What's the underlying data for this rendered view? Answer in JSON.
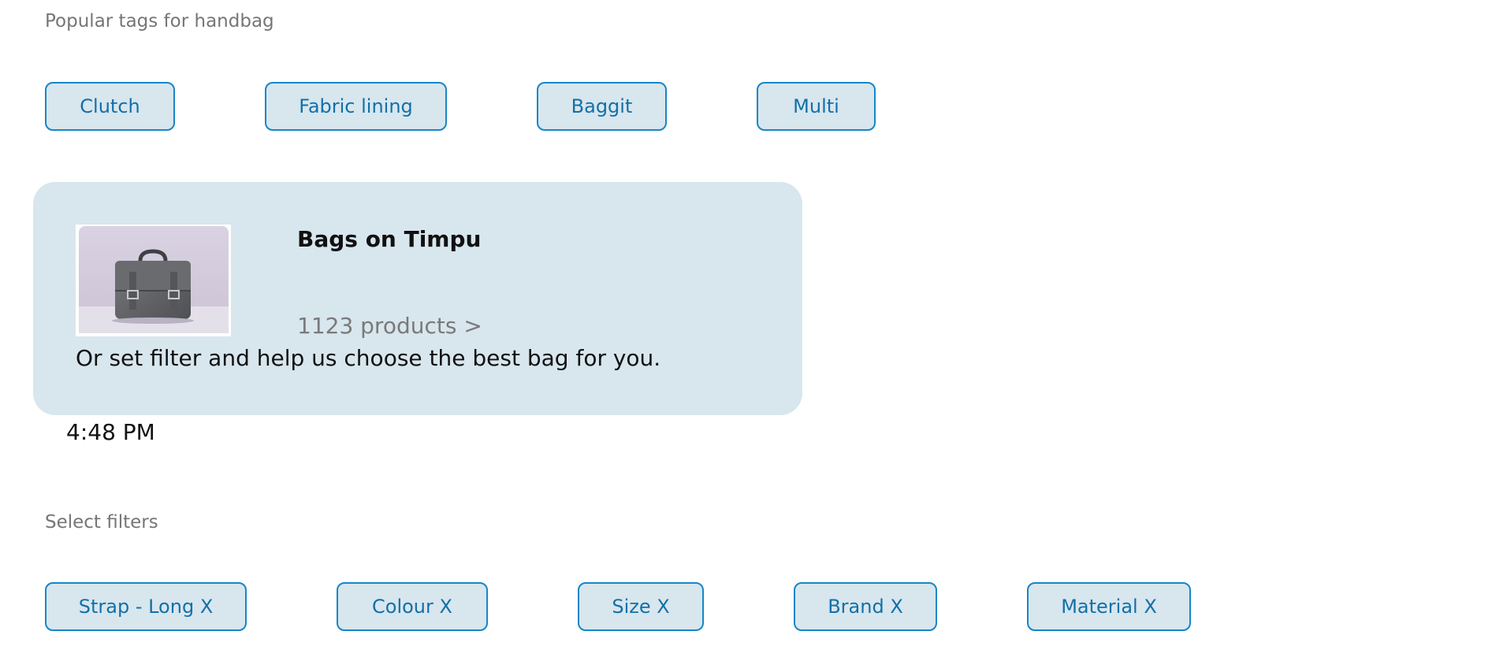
{
  "tags": {
    "label": "Popular tags for handbag",
    "items": [
      "Clutch",
      "Fabric lining",
      "Baggit",
      "Multi"
    ]
  },
  "card": {
    "title": "Bags on Timpu",
    "count_text": "1123 products >",
    "message": "Or set filter and help us choose the best bag for you.",
    "image_icon": "handbag-photo"
  },
  "timestamp": "4:48 PM",
  "filters": {
    "label": "Select filters",
    "items": [
      "Strap - Long X",
      "Colour X",
      "Size X",
      "Brand X",
      "Material X"
    ]
  },
  "colors": {
    "chip_border": "#1686c8",
    "chip_background": "#d8e6ee",
    "chip_text": "#1270a8",
    "card_background": "#d8e6ee",
    "label_text": "#767676"
  }
}
